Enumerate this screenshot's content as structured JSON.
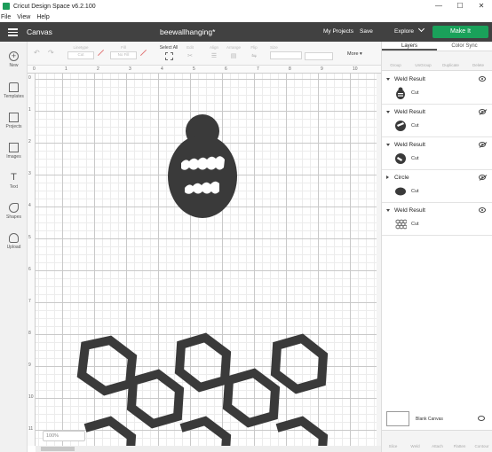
{
  "window": {
    "title": "Cricut Design Space  v6.2.100",
    "controls": [
      "—",
      "☐",
      "✕"
    ]
  },
  "menu": [
    "File",
    "View",
    "Help"
  ],
  "header": {
    "section": "Canvas",
    "document_title": "beewallhanging*",
    "my_projects": "My Projects",
    "save": "Save",
    "machine": "Explore",
    "make_it": "Make It",
    "colors": {
      "header_bg": "#414141",
      "make_it": "#1aa15a"
    }
  },
  "toolbar": {
    "linetype": "Linetype",
    "linetype_value": "Cut",
    "fill": "Fill",
    "fill_value": "No Fill",
    "select_all": "Select All",
    "edit": "Edit",
    "align": "Align",
    "arrange": "Arrange",
    "flip": "Flip",
    "size": "Size",
    "more": "More"
  },
  "sidebar": [
    {
      "label": "New",
      "icon": "plus-icon"
    },
    {
      "label": "Templates",
      "icon": "shirt-icon"
    },
    {
      "label": "Projects",
      "icon": "projects-icon"
    },
    {
      "label": "Images",
      "icon": "image-icon"
    },
    {
      "label": "Text",
      "icon": "text-icon"
    },
    {
      "label": "Shapes",
      "icon": "shapes-icon"
    },
    {
      "label": "Upload",
      "icon": "cloud-upload-icon"
    }
  ],
  "rulers": {
    "left": [
      "0",
      "1",
      "2",
      "3",
      "4",
      "5",
      "6",
      "7",
      "8",
      "9",
      "10",
      "11"
    ],
    "top": [
      "0",
      "1",
      "2",
      "3",
      "4",
      "5",
      "6",
      "7",
      "8",
      "9",
      "10"
    ]
  },
  "zoom": "100%",
  "layers_panel": {
    "tabs": [
      "Layers",
      "Color Sync"
    ],
    "actions": [
      "Group",
      "UnGroup",
      "Duplicate",
      "Delete"
    ],
    "groups": [
      {
        "title": "Weld Result",
        "item": "Cut",
        "visible": true
      },
      {
        "title": "Weld Result",
        "item": "Cut",
        "visible": false
      },
      {
        "title": "Weld Result",
        "item": "Cut",
        "visible": false
      },
      {
        "title": "Circle",
        "item": "Cut",
        "visible": false
      },
      {
        "title": "Weld Result",
        "item": "Cut",
        "visible": true
      }
    ],
    "blank_canvas": "Blank Canvas",
    "bottom_actions": [
      "Slice",
      "Weld",
      "Attach",
      "Flatten",
      "Contour"
    ]
  }
}
